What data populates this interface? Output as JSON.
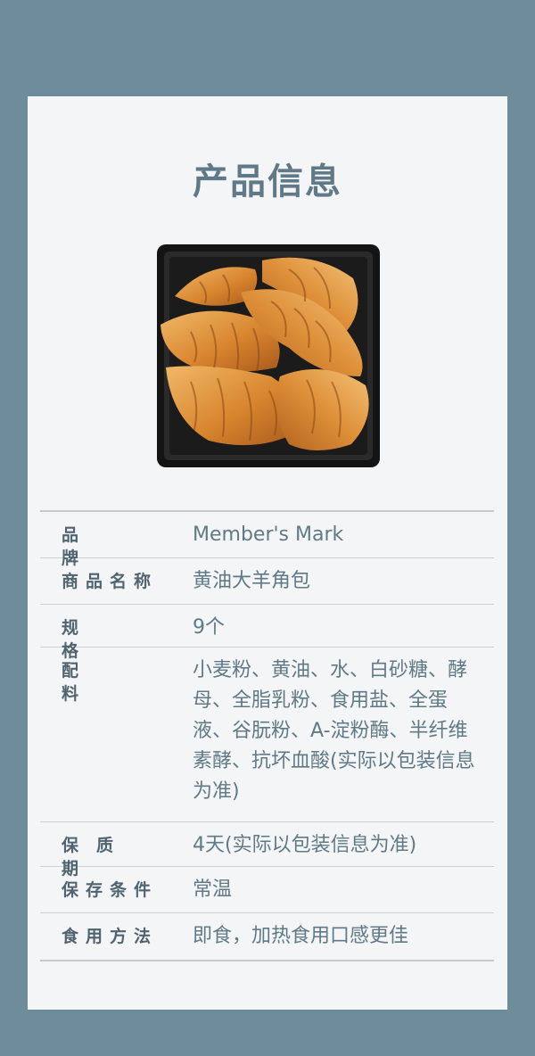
{
  "header": {
    "title": "产品信息"
  },
  "product_image": {
    "icon": "croissant-tray-photo"
  },
  "info_rows": [
    {
      "label": "品牌",
      "value": "Member's Mark"
    },
    {
      "label": "商品名称",
      "value": "黄油大羊角包"
    },
    {
      "label": "规格",
      "value": "9个"
    },
    {
      "label": "配料",
      "value": "小麦粉、黄油、水、白砂糖、酵母、全脂乳粉、食用盐、全蛋液、谷朊粉、A-淀粉酶、半纤维素酵、抗坏血酸(实际以包装信息为准)"
    },
    {
      "label": "保质期",
      "value": "4天(实际以包装信息为准)"
    },
    {
      "label": "保存条件",
      "value": "常温"
    },
    {
      "label": "食用方法",
      "value": "即食，加热食用口感更佳"
    }
  ],
  "colors": {
    "background": "#6e8c99",
    "card": "#f4f5f7",
    "title": "#5f7a86",
    "label": "#4f6470",
    "value": "#5f7a86"
  }
}
